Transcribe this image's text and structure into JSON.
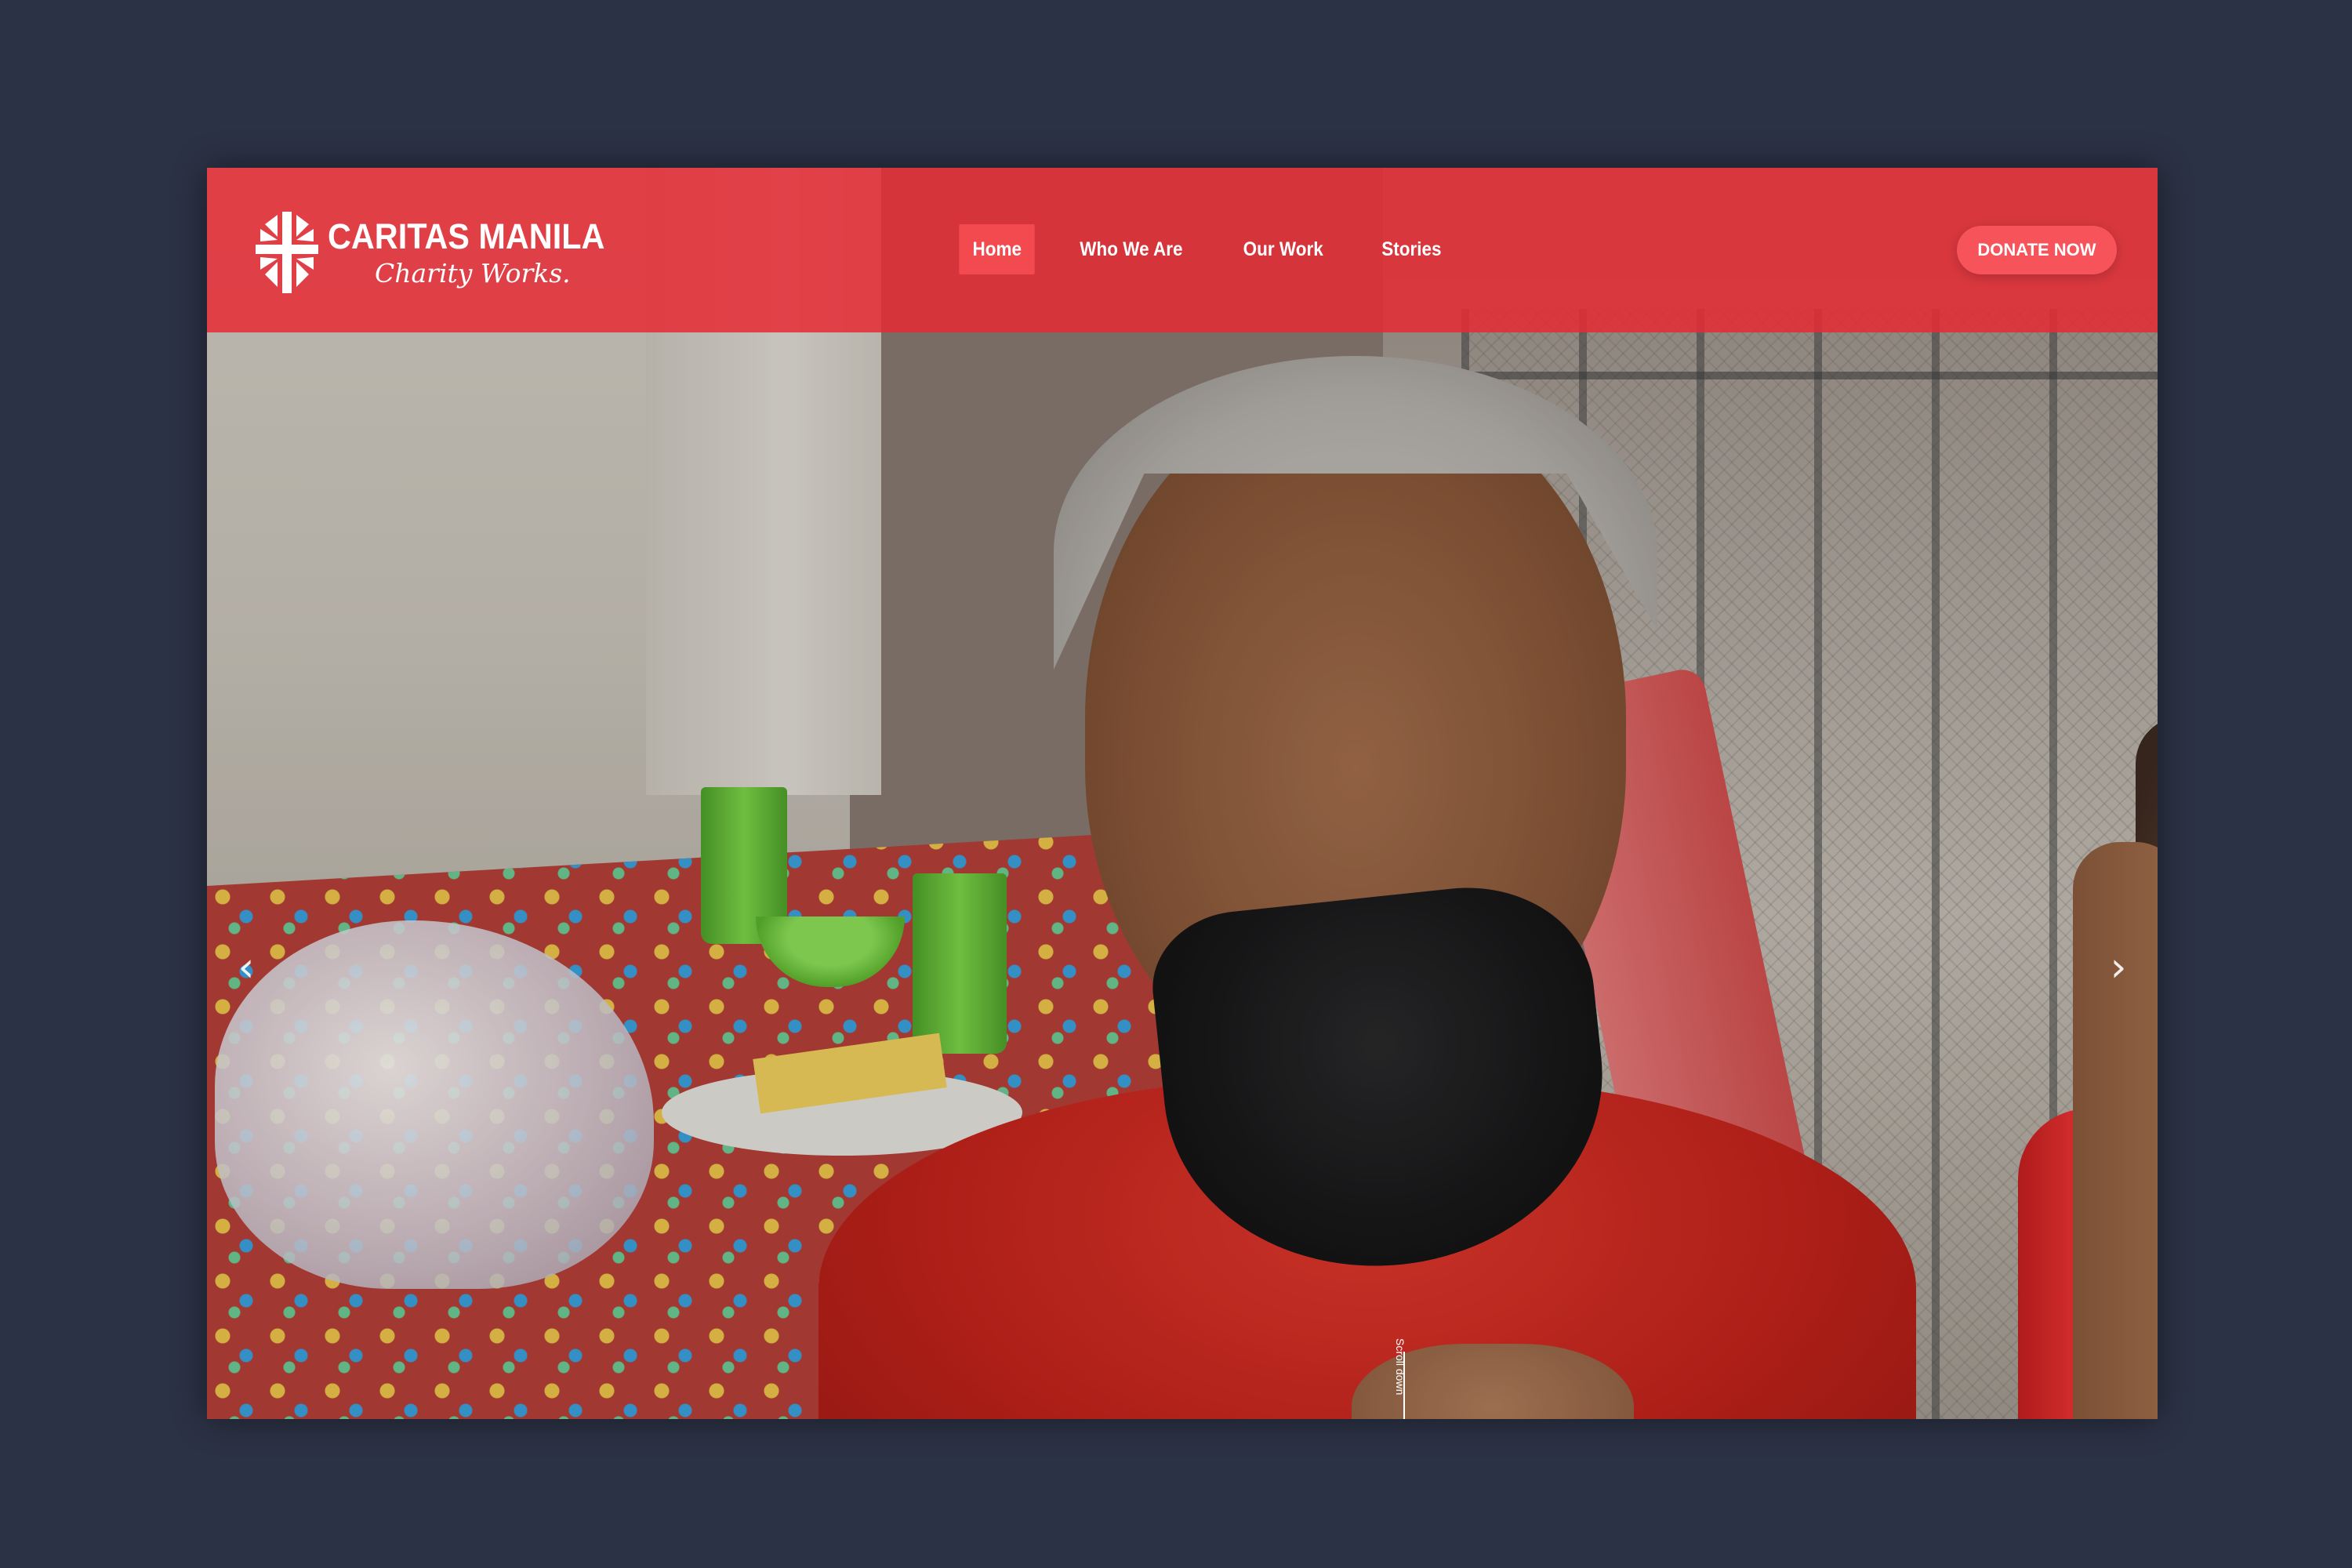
{
  "brand": {
    "name": "CARITAS MANILA",
    "tagline": "Charity Works.",
    "logo_icon": "caritas-cross-icon"
  },
  "nav": {
    "items": [
      {
        "label": "Home",
        "active": true
      },
      {
        "label": "Who We Are",
        "active": false
      },
      {
        "label": "Our Work",
        "active": false
      },
      {
        "label": "Stories",
        "active": false
      }
    ]
  },
  "cta": {
    "donate_label": "DONATE NOW"
  },
  "hero": {
    "prev_icon": "chevron-left-icon",
    "next_icon": "chevron-right-icon",
    "prev_glyph": "‹",
    "next_glyph": "›",
    "scroll_label": "Scroll down"
  },
  "colors": {
    "page_background": "#2c3245",
    "header_red": "#e52b34",
    "active_nav": "#f24a4f",
    "donate_button": "#f6535b"
  }
}
